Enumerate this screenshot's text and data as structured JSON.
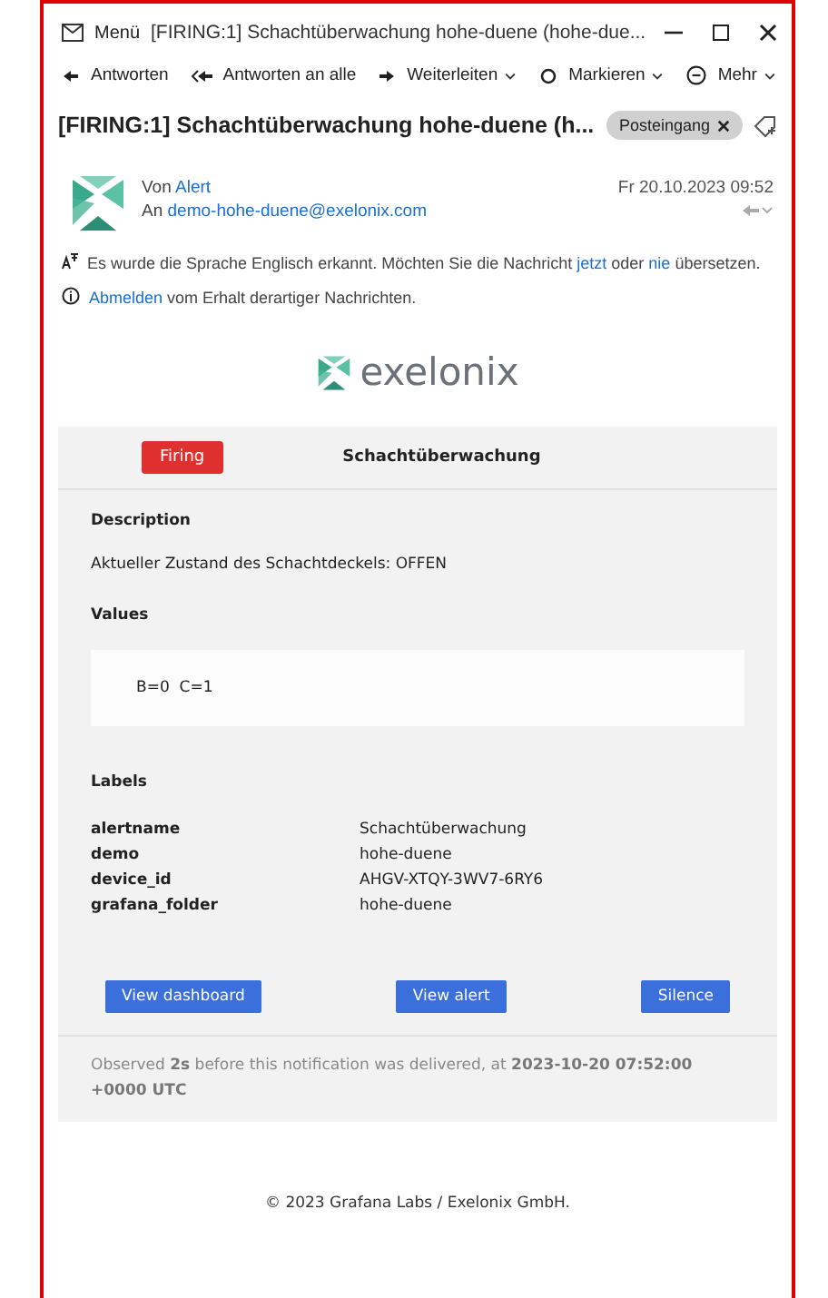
{
  "window": {
    "menu": "Menü",
    "title": "[FIRING:1] Schachtüberwachung hohe-duene (hohe-due..."
  },
  "toolbar": [
    {
      "label": "Antworten",
      "kind": "reply"
    },
    {
      "label": "Antworten an alle",
      "kind": "reply_all"
    },
    {
      "label": "Weiterleiten",
      "kind": "forward"
    },
    {
      "label": "Markieren",
      "kind": "flag"
    },
    {
      "label": "Mehr",
      "kind": "more"
    }
  ],
  "subject": {
    "title": "[FIRING:1] Schachtüberwachung hohe-duene (h...",
    "folder_tag": "Posteingang"
  },
  "message": {
    "from_label": "Von",
    "from": "Alert",
    "to_label": "An",
    "to": "demo-hohe-duene@exelonix.com",
    "date": "Fr 20.10.2023 09:52"
  },
  "translation_notice": [
    {
      "kind": "text",
      "text": "Es wurde die Sprache Englisch erkannt. Möchten Sie die Nachricht "
    },
    {
      "kind": "link",
      "text": "jetzt"
    },
    {
      "kind": "text",
      "text": " oder "
    },
    {
      "kind": "link",
      "text": "nie"
    },
    {
      "kind": "text",
      "text": " übersetzen."
    }
  ],
  "unsubscribe": {
    "link": "Abmelden",
    "text": " vom Erhalt derartiger Nachrichten."
  },
  "logo": {
    "text": "exelonix"
  },
  "alert": {
    "status": {
      "label": "Firing",
      "kind": "firing"
    },
    "name": "Schachtüberwachung",
    "description_title": "Description",
    "description": "Aktueller Zustand des Schachtdeckels: OFFEN",
    "values_title": "Values",
    "values": "B=0  C=1",
    "labels_title": "Labels",
    "labels": [
      {
        "key": "alertname",
        "value": "Schachtüberwachung"
      },
      {
        "key": "demo",
        "value": "hohe-duene"
      },
      {
        "key": "device_id",
        "value": "AHGV-XTQY-3WV7-6RY6"
      },
      {
        "key": "grafana_folder",
        "value": "hohe-duene"
      }
    ],
    "buttons": [
      "View dashboard",
      "View alert",
      "Silence"
    ],
    "observed": "Observed **2s** before this notification was delivered, at **2023-10-20 07:52:00 +0000 UTC**"
  },
  "footer": "© 2023 Grafana Labs / Exelonix GmbH."
}
